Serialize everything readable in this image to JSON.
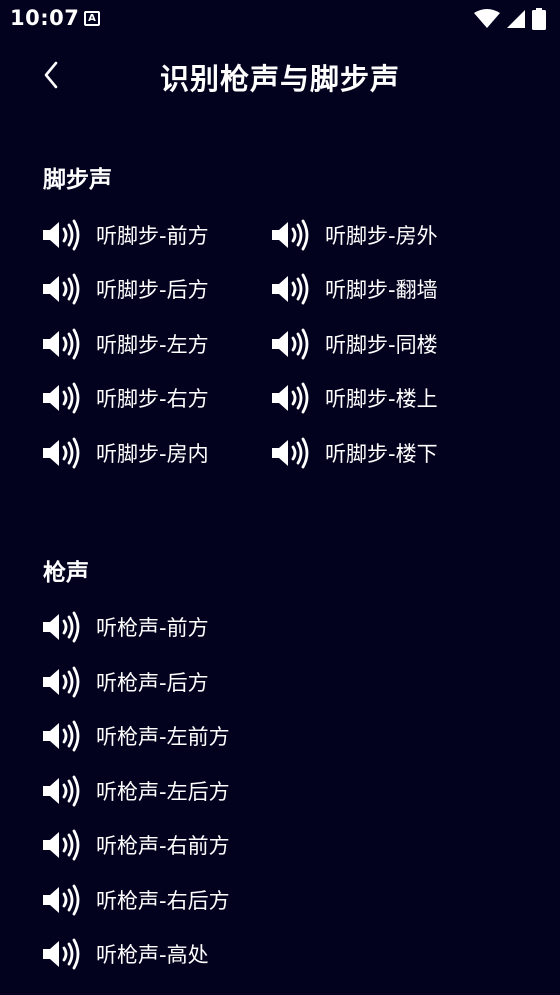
{
  "status_bar": {
    "time": "10:07",
    "notification_glyph": "A"
  },
  "app_bar": {
    "title": "识别枪声与脚步声"
  },
  "sections": {
    "footsteps": {
      "title": "脚步声",
      "items": [
        "听脚步-前方",
        "听脚步-房外",
        "听脚步-后方",
        "听脚步-翻墙",
        "听脚步-左方",
        "听脚步-同楼",
        "听脚步-右方",
        "听脚步-楼上",
        "听脚步-房内",
        "听脚步-楼下"
      ]
    },
    "gunshots": {
      "title": "枪声",
      "items": [
        "听枪声-前方",
        "听枪声-后方",
        "听枪声-左前方",
        "听枪声-左后方",
        "听枪声-右前方",
        "听枪声-右后方",
        "听枪声-高处"
      ]
    }
  },
  "icons": {
    "back": "chevron-left-icon",
    "sound": "speaker-icon"
  },
  "colors": {
    "background": "#02021f",
    "text": "#ffffff"
  }
}
